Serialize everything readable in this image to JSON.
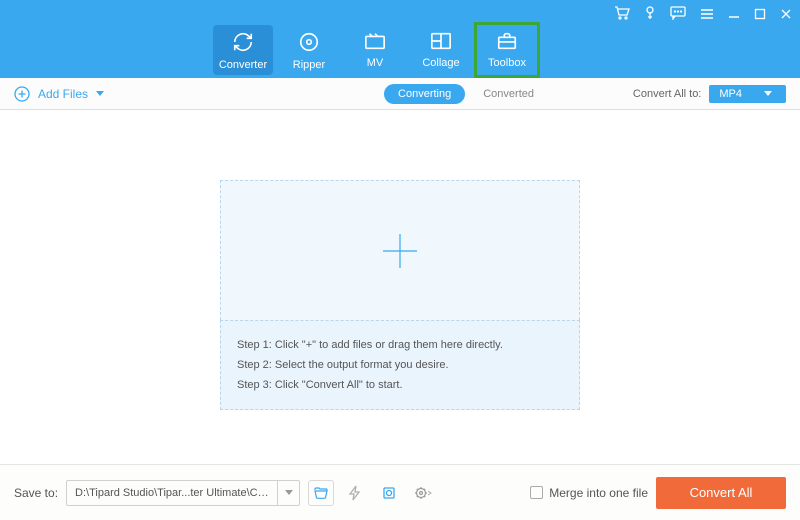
{
  "nav": {
    "items": [
      {
        "label": "Converter"
      },
      {
        "label": "Ripper"
      },
      {
        "label": "MV"
      },
      {
        "label": "Collage"
      },
      {
        "label": "Toolbox"
      }
    ]
  },
  "toolbar": {
    "add_files": "Add Files",
    "tab_converting": "Converting",
    "tab_converted": "Converted",
    "convert_all_to_label": "Convert All to:",
    "format": "MP4"
  },
  "drop": {
    "step1": "Step 1: Click \"+\" to add files or drag them here directly.",
    "step2": "Step 2: Select the output format you desire.",
    "step3": "Step 3: Click \"Convert All\" to start."
  },
  "footer": {
    "save_label": "Save to:",
    "path": "D:\\Tipard Studio\\Tipar...ter Ultimate\\Converted",
    "merge_label": "Merge into one file",
    "convert_all": "Convert All"
  }
}
